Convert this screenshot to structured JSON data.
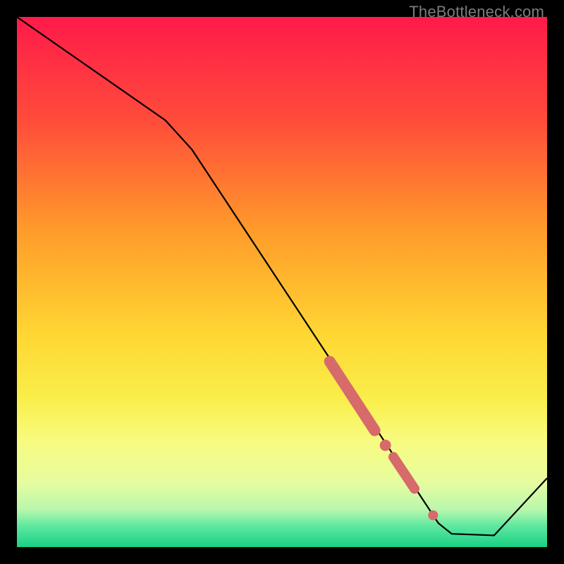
{
  "watermark": "TheBottleneck.com",
  "chart_data": {
    "type": "line",
    "title": "",
    "xlabel": "",
    "ylabel": "",
    "xlim": [
      0,
      100
    ],
    "ylim": [
      0,
      100
    ],
    "background": {
      "type": "vertical-gradient",
      "stops": [
        {
          "offset": 0.0,
          "color": "#ff1a4a"
        },
        {
          "offset": 0.2,
          "color": "#ff4d3a"
        },
        {
          "offset": 0.4,
          "color": "#ff9a2a"
        },
        {
          "offset": 0.6,
          "color": "#ffd733"
        },
        {
          "offset": 0.72,
          "color": "#f9ee4a"
        },
        {
          "offset": 0.8,
          "color": "#f8fb80"
        },
        {
          "offset": 0.88,
          "color": "#e6fca0"
        },
        {
          "offset": 0.93,
          "color": "#b7f7ad"
        },
        {
          "offset": 0.96,
          "color": "#5fe8a0"
        },
        {
          "offset": 1.0,
          "color": "#18d183"
        }
      ]
    },
    "series": [
      {
        "name": "curve",
        "color": "#000000",
        "width": 2.2,
        "points": [
          {
            "x": 0.0,
            "y": 100.0
          },
          {
            "x": 28.0,
            "y": 80.5
          },
          {
            "x": 33.0,
            "y": 75.0
          },
          {
            "x": 79.5,
            "y": 4.5
          },
          {
            "x": 82.0,
            "y": 2.5
          },
          {
            "x": 90.0,
            "y": 2.2
          },
          {
            "x": 100.0,
            "y": 13.0
          }
        ]
      }
    ],
    "markers": [
      {
        "name": "thick-segment-1",
        "type": "thick-line",
        "color": "#d76a6a",
        "width": 16,
        "from": {
          "x": 59.0,
          "y": 35.0
        },
        "to": {
          "x": 67.5,
          "y": 22.0
        }
      },
      {
        "name": "dot-1",
        "type": "dot",
        "color": "#d76a6a",
        "r": 8,
        "at": {
          "x": 69.5,
          "y": 19.2
        }
      },
      {
        "name": "thick-segment-2",
        "type": "thick-line",
        "color": "#d76a6a",
        "width": 14,
        "from": {
          "x": 71.0,
          "y": 17.0
        },
        "to": {
          "x": 75.0,
          "y": 11.0
        }
      },
      {
        "name": "dot-2",
        "type": "dot",
        "color": "#d76a6a",
        "r": 7,
        "at": {
          "x": 78.5,
          "y": 6.0
        }
      }
    ]
  }
}
